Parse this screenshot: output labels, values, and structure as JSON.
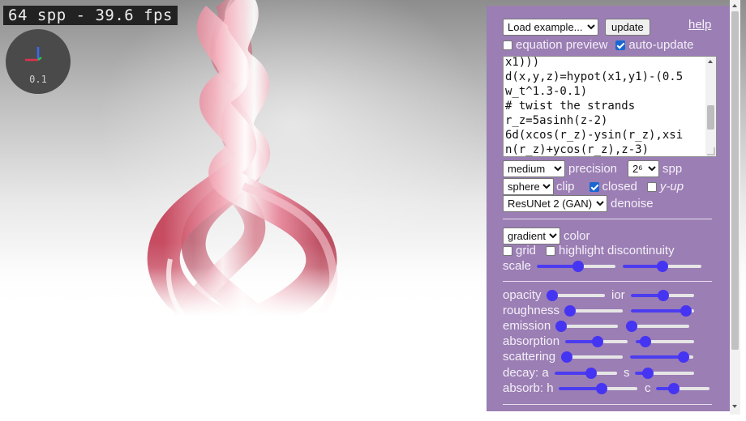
{
  "viewport": {
    "stats": "64 spp - 39.6 fps",
    "gizmo_label": "0.1",
    "render_colors": {
      "strand": "#e0607a",
      "background_top": "#8d8d8d",
      "floor": "#ffffff"
    }
  },
  "panel": {
    "accent": "#9b7eb4",
    "example_select": "Load example...",
    "update_button": "update",
    "help_link": "help",
    "equation_preview": {
      "label": "equation preview",
      "checked": false
    },
    "auto_update": {
      "label": "auto-update",
      "checked": true
    },
    "code_lines": [
      "x1)))",
      "d(x,y,z)=hypot(x1,y1)-(0.5",
      "w_t^1.3-0.1)",
      "# twist the strands",
      "r_z=5asinh(z-2)",
      "6d(xcos(r_z)-ysin(r_z),xsi",
      "n(r_z)+ycos(r_z),z-3)"
    ],
    "precision_select": "medium",
    "precision_label": "precision",
    "spp_select": "2⁶",
    "spp_label": "spp",
    "clip_select": "sphere",
    "clip_label": "clip",
    "closed": {
      "label": "closed",
      "checked": true
    },
    "y_up": {
      "label": "y-up",
      "checked": false
    },
    "denoise_select": "ResUNet 2 (GAN)",
    "denoise_label": "denoise",
    "color_select": "gradient",
    "color_label": "color",
    "grid": {
      "label": "grid",
      "checked": false
    },
    "highlight": {
      "label": "highlight discontinuity",
      "checked": false
    },
    "scale_label": "scale",
    "scale_sliders": [
      0.53,
      0.5
    ],
    "opacity_label": "opacity",
    "opacity_value": 0.0,
    "ior_label": "ior",
    "ior_value": 0.52,
    "roughness_label": "roughness",
    "roughness_value": 0.0,
    "roughness2_value": 0.95,
    "emission_label": "emission",
    "emission_value": 0.0,
    "emission2_value": 0.0,
    "absorption_label": "absorption",
    "absorption_value": 0.53,
    "absorption2_value": 0.08,
    "scattering_label": "scattering",
    "scattering_value": 0.0,
    "scattering2_value": 0.92,
    "decay_a_label": "decay: a",
    "decay_a_value": 0.6,
    "decay_s_label": "s",
    "decay_s_value": 0.15,
    "absorb_h_label": "absorb: h",
    "absorb_h_value": 0.55,
    "absorb_c_label": "c",
    "absorb_c_value": 0.28
  }
}
